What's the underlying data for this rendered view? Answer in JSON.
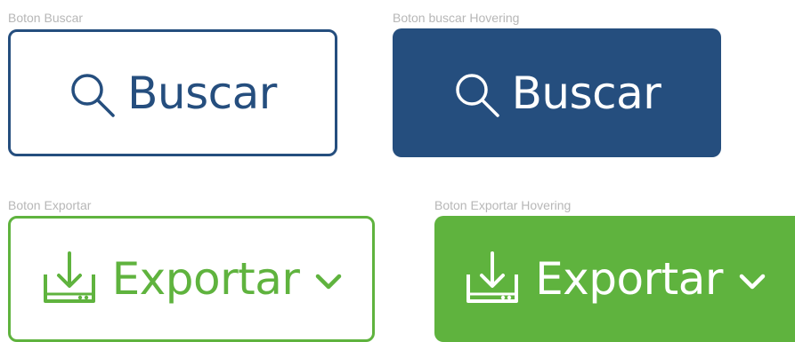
{
  "labels": {
    "buscar": "Boton Buscar",
    "buscar_hover": "Boton buscar Hovering",
    "exportar": "Boton Exportar",
    "exportar_hover": "Boton Exportar Hovering"
  },
  "buttons": {
    "buscar": {
      "text": "Buscar",
      "icon": "search-icon"
    },
    "buscar_hover": {
      "text": "Buscar",
      "icon": "search-icon"
    },
    "exportar": {
      "text": "Exportar",
      "icon": "download-icon",
      "trailing_icon": "chevron-down-icon"
    },
    "exportar_hover": {
      "text": "Exportar",
      "icon": "download-icon",
      "trailing_icon": "chevron-down-icon"
    }
  },
  "colors": {
    "blue": "#254e7e",
    "green": "#5fb33e",
    "label_gray": "#b7b7b7",
    "white": "#ffffff"
  }
}
